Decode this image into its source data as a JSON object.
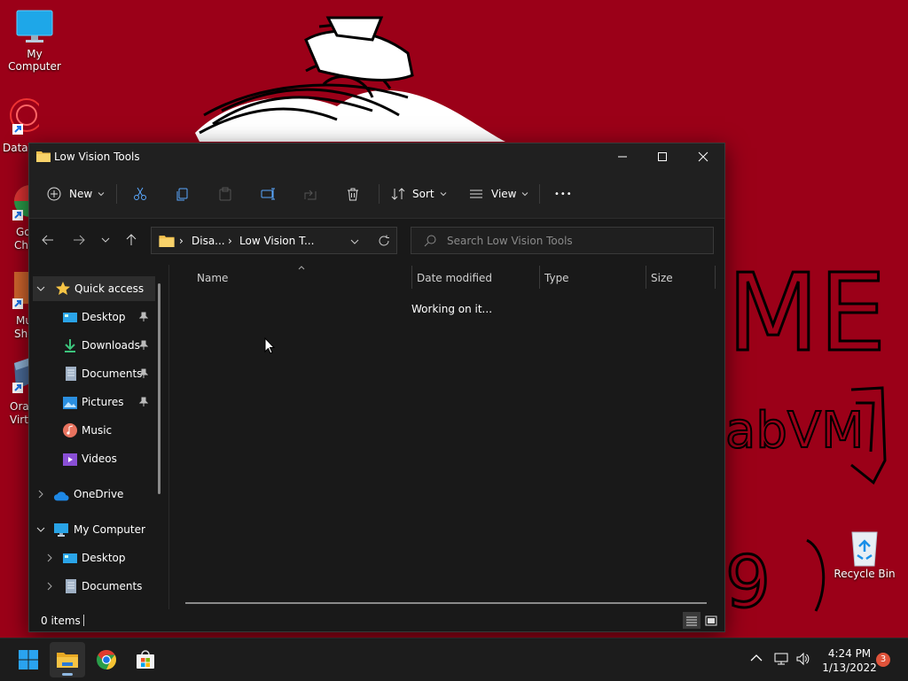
{
  "desktop": {
    "icons": [
      {
        "label": "My Computer"
      },
      {
        "label": "Recycle Bin"
      }
    ],
    "partial_labels": [
      "DataV",
      "Go",
      "Ch",
      "Mu",
      "Sho",
      "Ora",
      "Virtu"
    ],
    "scribble_text": {
      "line1": "ME",
      "line2": "abVM",
      "line3": "9"
    }
  },
  "window": {
    "title": "Low Vision Tools",
    "toolbar": {
      "new_label": "New",
      "sort_label": "Sort",
      "view_label": "View",
      "more_label": "•••"
    },
    "address": {
      "crumb1": "Disa...",
      "crumb2": "Low Vision T..."
    },
    "search": {
      "placeholder": "Search Low Vision Tools"
    },
    "nav": {
      "quick_access": "Quick access",
      "desktop": "Desktop",
      "downloads": "Downloads",
      "documents": "Documents",
      "pictures": "Pictures",
      "music": "Music",
      "videos": "Videos",
      "onedrive": "OneDrive",
      "my_computer": "My Computer",
      "mc_desktop": "Desktop",
      "mc_documents": "Documents"
    },
    "columns": {
      "name": "Name",
      "date_modified": "Date modified",
      "type": "Type",
      "size": "Size"
    },
    "content_status": "Working on it...",
    "status_count": "0 items"
  },
  "taskbar": {
    "time": "4:24 PM",
    "date": "1/13/2022",
    "notification_count": "3"
  },
  "colors": {
    "desktop_bg": "#9b0018",
    "window_bg": "#191919",
    "accent": "#0078d4"
  }
}
